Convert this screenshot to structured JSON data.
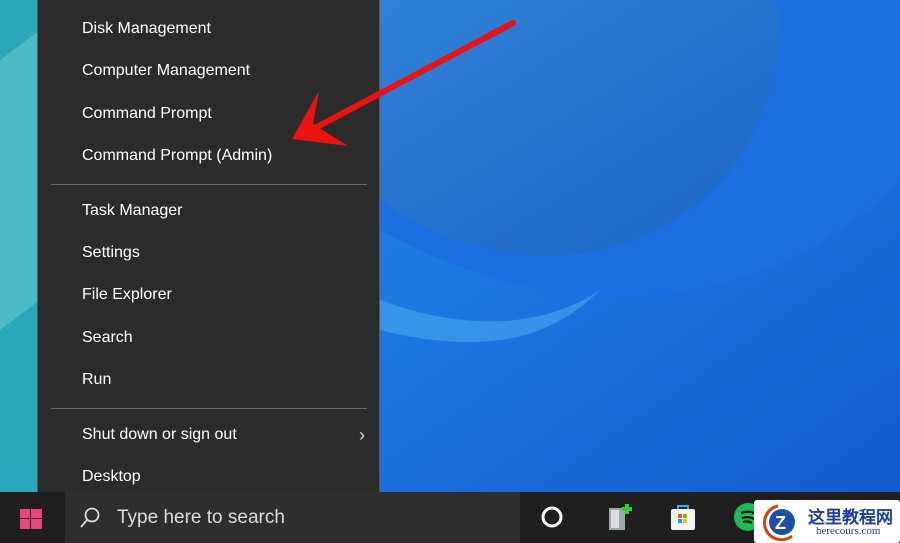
{
  "menu": {
    "items": [
      {
        "label": "Disk Management"
      },
      {
        "label": "Computer Management"
      },
      {
        "label": "Command Prompt"
      },
      {
        "label": "Command Prompt (Admin)"
      },
      {
        "label": "Task Manager"
      },
      {
        "label": "Settings"
      },
      {
        "label": "File Explorer"
      },
      {
        "label": "Search"
      },
      {
        "label": "Run"
      },
      {
        "label": "Shut down or sign out"
      },
      {
        "label": "Desktop"
      }
    ]
  },
  "taskbar": {
    "search_placeholder": "Type here to search"
  },
  "watermark": {
    "title": "这里教程网",
    "url": "herecours.com"
  },
  "colors": {
    "arrow": "#ee1111",
    "menu_bg": "#2b2b2b",
    "taskbar_bg": "#1f1f1f",
    "start": "#e8457a"
  }
}
